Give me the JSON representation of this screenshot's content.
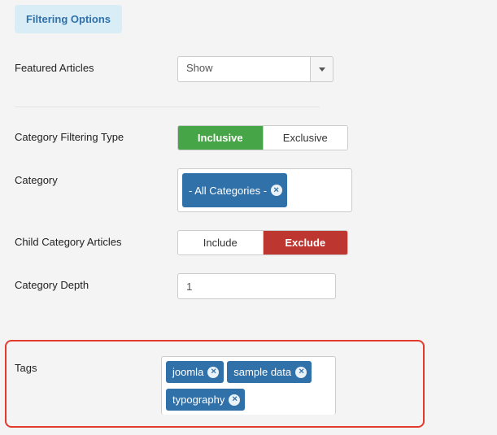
{
  "tab": {
    "label": "Filtering Options"
  },
  "fields": {
    "featured": {
      "label": "Featured Articles",
      "value": "Show"
    },
    "catFilterType": {
      "label": "Category Filtering Type",
      "options": [
        "Inclusive",
        "Exclusive"
      ],
      "selected": 0
    },
    "category": {
      "label": "Category",
      "chips": [
        "- All Categories -"
      ]
    },
    "childCat": {
      "label": "Child Category Articles",
      "options": [
        "Include",
        "Exclude"
      ],
      "selected": 1
    },
    "depth": {
      "label": "Category Depth",
      "value": "1"
    },
    "tags": {
      "label": "Tags",
      "chips": [
        "joomla",
        "sample data",
        "typography"
      ]
    }
  }
}
